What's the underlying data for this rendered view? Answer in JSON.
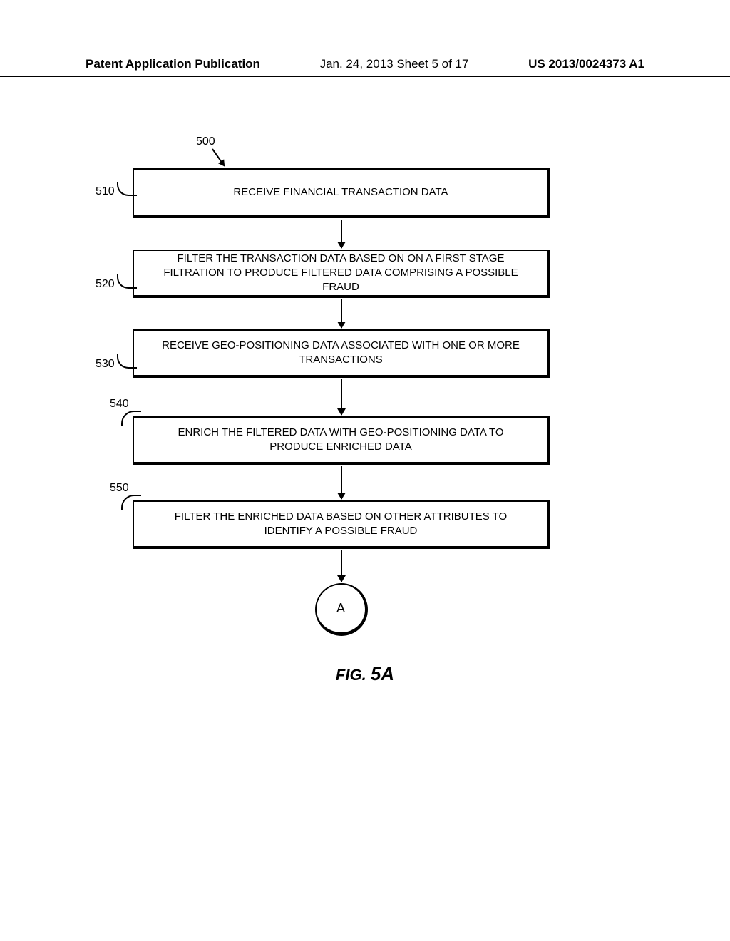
{
  "header": {
    "left": "Patent Application Publication",
    "center": "Jan. 24, 2013  Sheet 5 of 17",
    "right": "US 2013/0024373 A1"
  },
  "refs": {
    "r500": "500",
    "r510": "510",
    "r520": "520",
    "r530": "530",
    "r540": "540",
    "r550": "550"
  },
  "boxes": {
    "b510": "RECEIVE FINANCIAL TRANSACTION DATA",
    "b520": "FILTER THE TRANSACTION DATA BASED ON ON A FIRST STAGE FILTRATION TO PRODUCE FILTERED DATA COMPRISING A POSSIBLE FRAUD",
    "b530": "RECEIVE GEO-POSITIONING DATA ASSOCIATED WITH ONE OR MORE TRANSACTIONS",
    "b540": "ENRICH THE FILTERED DATA WITH GEO-POSITIONING DATA TO PRODUCE ENRICHED DATA",
    "b550": "FILTER THE ENRICHED DATA BASED ON OTHER ATTRIBUTES TO IDENTIFY A POSSIBLE FRAUD"
  },
  "connector": "A",
  "figure_label": {
    "prefix": "FIG. ",
    "number": "5A"
  }
}
